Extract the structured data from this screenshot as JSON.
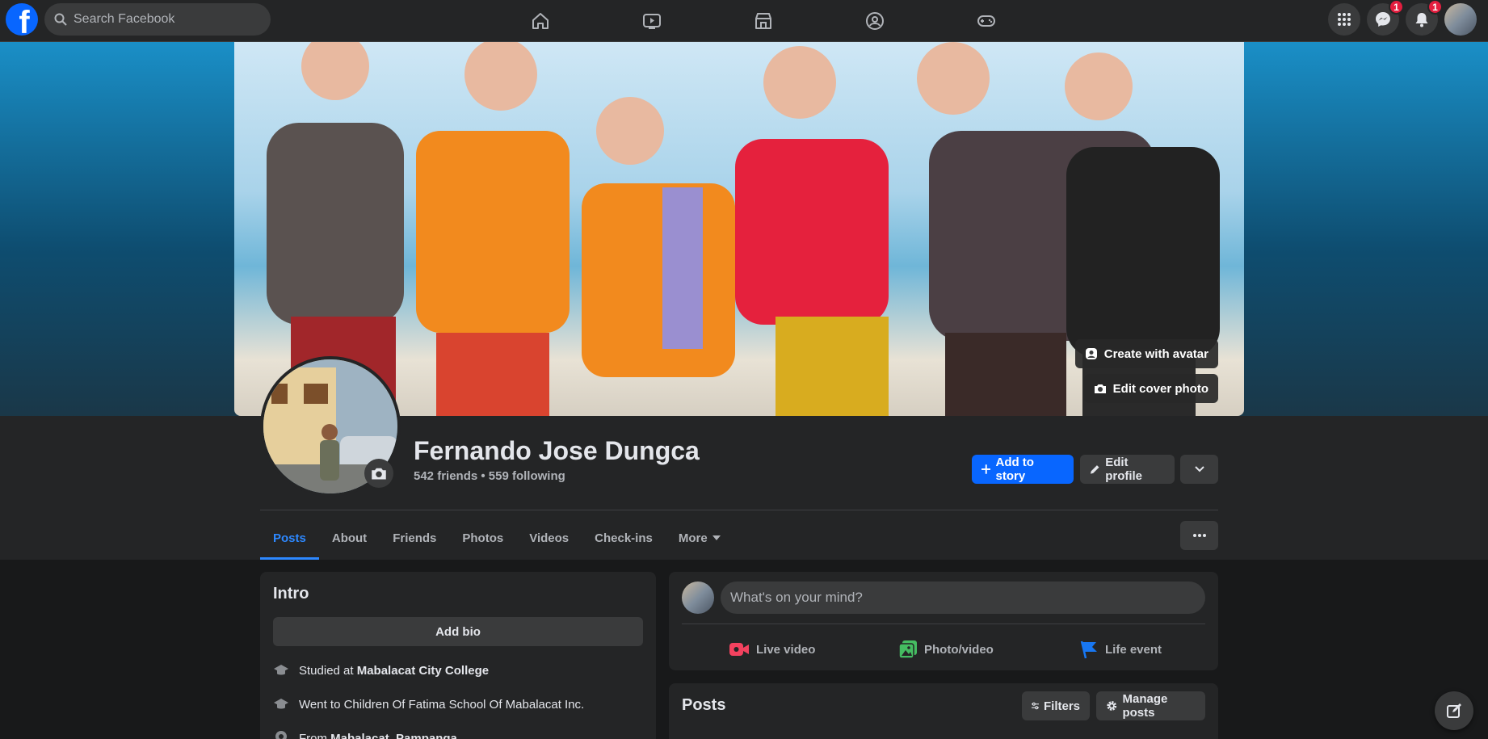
{
  "topbar": {
    "logo_letter": "f",
    "search_placeholder": "Search Facebook",
    "nav_icons": [
      "home-icon",
      "watch-icon",
      "marketplace-icon",
      "groups-icon",
      "gaming-icon"
    ],
    "messenger_badge": "1",
    "notifications_badge": "1"
  },
  "cover": {
    "create_avatar_label": "Create with avatar",
    "edit_cover_label": "Edit cover photo"
  },
  "profile": {
    "name": "Fernando Jose Dungca",
    "stats": "542 friends • 559 following",
    "add_story_label": "Add to story",
    "edit_profile_label": "Edit profile"
  },
  "tabs": [
    {
      "label": "Posts",
      "active": true
    },
    {
      "label": "About"
    },
    {
      "label": "Friends"
    },
    {
      "label": "Photos"
    },
    {
      "label": "Videos"
    },
    {
      "label": "Check-ins"
    },
    {
      "label": "More"
    }
  ],
  "intro": {
    "title": "Intro",
    "add_bio_label": "Add bio",
    "items": [
      {
        "prefix": "Studied at ",
        "bold": "Mabalacat City College",
        "suffix": ""
      },
      {
        "prefix": "Went to ",
        "bold": "",
        "suffix": "Children Of Fatima School Of Mabalacat Inc."
      },
      {
        "prefix": "From ",
        "bold": "Mabalacat, Pampanga",
        "suffix": ""
      }
    ]
  },
  "composer": {
    "placeholder": "What's on your mind?",
    "live_video_label": "Live video",
    "photo_video_label": "Photo/video",
    "life_event_label": "Life event"
  },
  "posts": {
    "title": "Posts",
    "filters_label": "Filters",
    "manage_label": "Manage posts"
  },
  "colors": {
    "accent": "#0866ff",
    "background": "#18191a",
    "card": "#242526",
    "live_red": "#f3425f",
    "photo_green": "#45bd62",
    "life_blue": "#1877f2"
  }
}
